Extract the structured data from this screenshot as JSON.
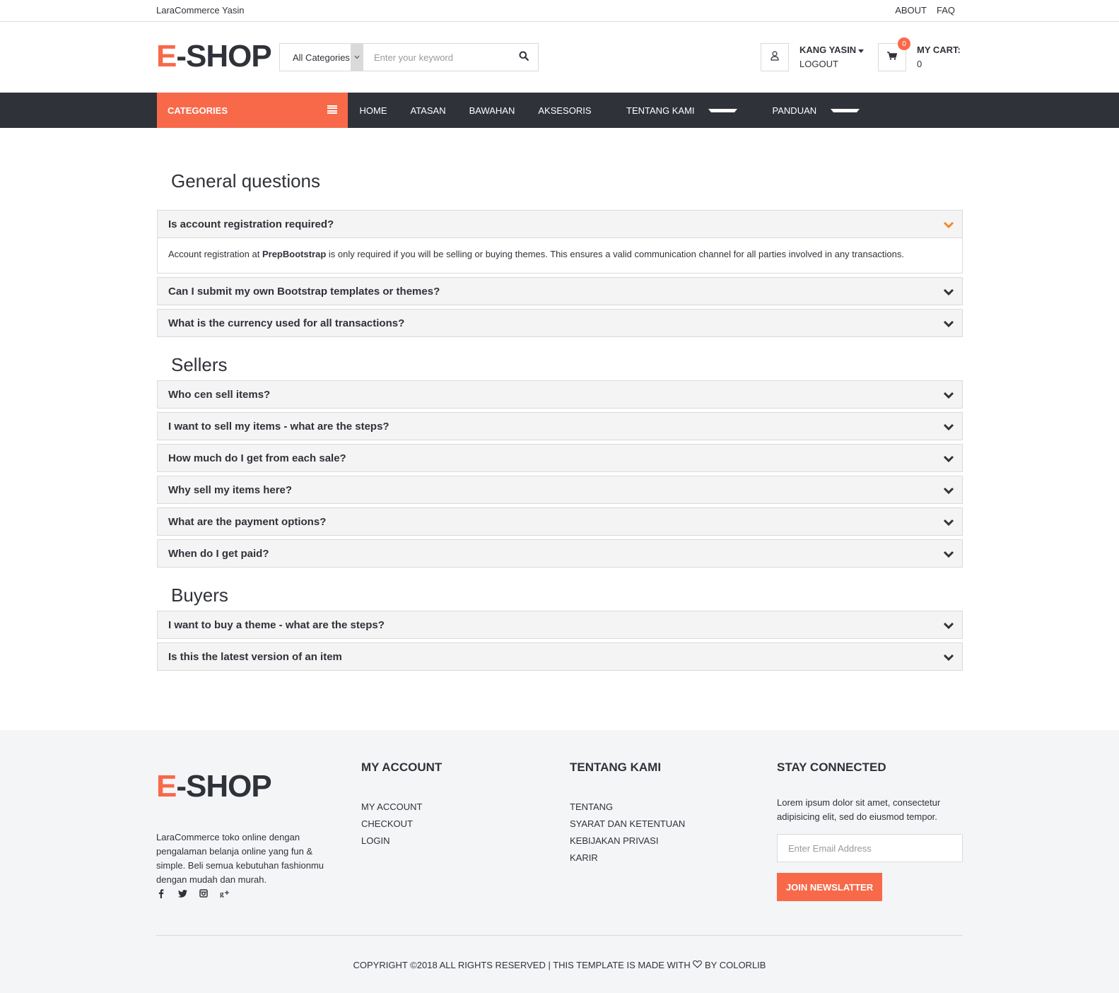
{
  "topbar": {
    "brand": "LaraCommerce Yasin",
    "links": [
      "ABOUT",
      "FAQ"
    ]
  },
  "header": {
    "logo_prefix": "E",
    "logo_rest": "-SHOP",
    "search": {
      "category": "All Categories",
      "placeholder": "Enter your keyword"
    },
    "account": {
      "name": "KANG YASIN",
      "logout": "LOGOUT"
    },
    "cart": {
      "label": "MY CART:",
      "total": "0",
      "qty": "0"
    }
  },
  "nav": {
    "categories_label": "CATEGORIES",
    "items": [
      "HOME",
      "ATASAN",
      "BAWAHAN",
      "AKSESORIS",
      "TENTANG KAMI",
      "PANDUAN"
    ]
  },
  "faq": {
    "general_title": "General questions",
    "general": [
      {
        "q": "Is account registration required?",
        "answer_pre": "Account registration at ",
        "answer_bold": "PrepBootstrap",
        "answer_post": " is only required if you will be selling or buying themes. This ensures a valid communication channel for all parties involved in any transactions."
      },
      {
        "q": "Can I submit my own Bootstrap templates or themes?"
      },
      {
        "q": "What is the currency used for all transactions?"
      }
    ],
    "sellers_title": "Sellers",
    "sellers": [
      {
        "q": "Who cen sell items?"
      },
      {
        "q": "I want to sell my items - what are the steps?"
      },
      {
        "q": "How much do I get from each sale?"
      },
      {
        "q": "Why sell my items here?"
      },
      {
        "q": "What are the payment options?"
      },
      {
        "q": "When do I get paid?"
      }
    ],
    "buyers_title": "Buyers",
    "buyers": [
      {
        "q": "I want to buy a theme - what are the steps?"
      },
      {
        "q": "Is this the latest version of an item"
      }
    ]
  },
  "footer": {
    "logo_prefix": "E",
    "logo_rest": "-SHOP",
    "about": "LaraCommerce toko online dengan pengalaman belanja online yang fun & simple. Beli semua kebutuhan fashionmu dengan mudah dan murah.",
    "my_account": {
      "title": "MY ACCOUNT",
      "links": [
        "MY ACCOUNT",
        "CHECKOUT",
        "LOGIN"
      ]
    },
    "tentang": {
      "title": "TENTANG KAMI",
      "links": [
        "TENTANG",
        "SYARAT DAN KETENTUAN",
        "KEBIJAKAN PRIVASI",
        "KARIR"
      ]
    },
    "stay": {
      "title": "STAY CONNECTED",
      "desc": "Lorem ipsum dolor sit amet, consectetur adipisicing elit, sed do eiusmod tempor.",
      "email_placeholder": "Enter Email Address",
      "button": "JOIN NEWSLATTER"
    },
    "copyright_pre": "COPYRIGHT ©2018 ALL RIGHTS RESERVED | THIS TEMPLATE IS MADE WITH",
    "copyright_post": "BY COLORLIB"
  },
  "colors": {
    "accent": "#f8694a",
    "dark": "#30323a",
    "open_chevron": "#f0892a"
  }
}
